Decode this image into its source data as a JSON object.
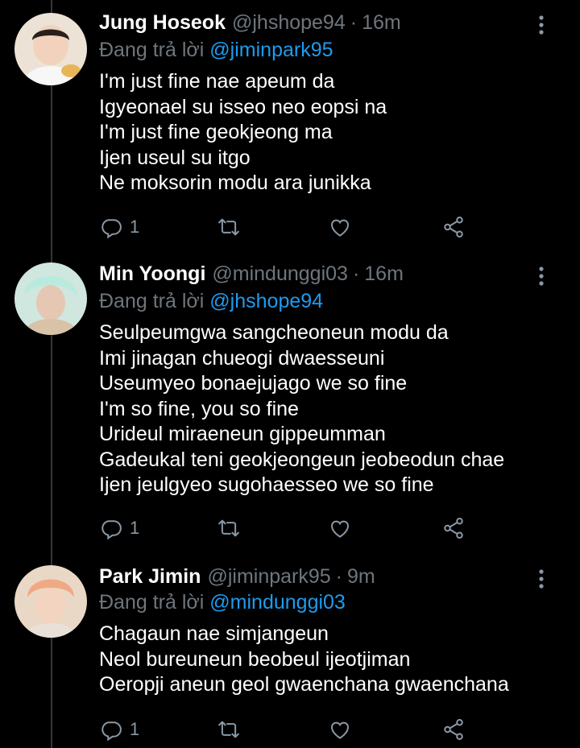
{
  "colors": {
    "background": "#000000",
    "text": "#ffffff",
    "muted": "#6e767d",
    "mention": "#1d9bf0",
    "thread_line": "#333639"
  },
  "reply_prefix": "Đang trả lời",
  "tweets": [
    {
      "name": "Jung Hoseok",
      "handle": "@jhshope94",
      "separator": "·",
      "time": "16m",
      "reply_to": "@jiminpark95",
      "lines": [
        "I'm just fine nae apeum da",
        "Igyeonael su isseo neo eopsi na",
        "I'm just fine geokjeong ma",
        "Ijen useul su itgo",
        "Ne moksorin modu ara junikka"
      ],
      "reply_count": "1",
      "icons": [
        "reply-icon",
        "retweet-icon",
        "like-icon",
        "share-icon",
        "more-icon"
      ]
    },
    {
      "name": "Min Yoongi",
      "handle": "@mindunggi03",
      "separator": "·",
      "time": "16m",
      "reply_to": "@jhshope94",
      "lines": [
        "Seulpeumgwa sangcheoneun modu da",
        "Imi jinagan chueogi dwaesseuni",
        "Useumyeo bonaejujago we so fine",
        "I'm so fine, you so fine",
        "Urideul miraeneun gippeumman",
        "Gadeukal teni geokjeongeun jeobeodun chae",
        "Ijen jeulgyeo sugohaesseo we so fine"
      ],
      "reply_count": "1",
      "icons": [
        "reply-icon",
        "retweet-icon",
        "like-icon",
        "share-icon",
        "more-icon"
      ]
    },
    {
      "name": "Park Jimin",
      "handle": "@jiminpark95",
      "separator": "·",
      "time": "9m",
      "reply_to": "@mindunggi03",
      "lines": [
        "Chagaun nae simjangeun",
        "Neol bureuneun beobeul ijeotjiman",
        "Oeropji aneun geol gwaenchana gwaenchana"
      ],
      "reply_count": "1",
      "icons": [
        "reply-icon",
        "retweet-icon",
        "like-icon",
        "share-icon",
        "more-icon"
      ]
    }
  ]
}
